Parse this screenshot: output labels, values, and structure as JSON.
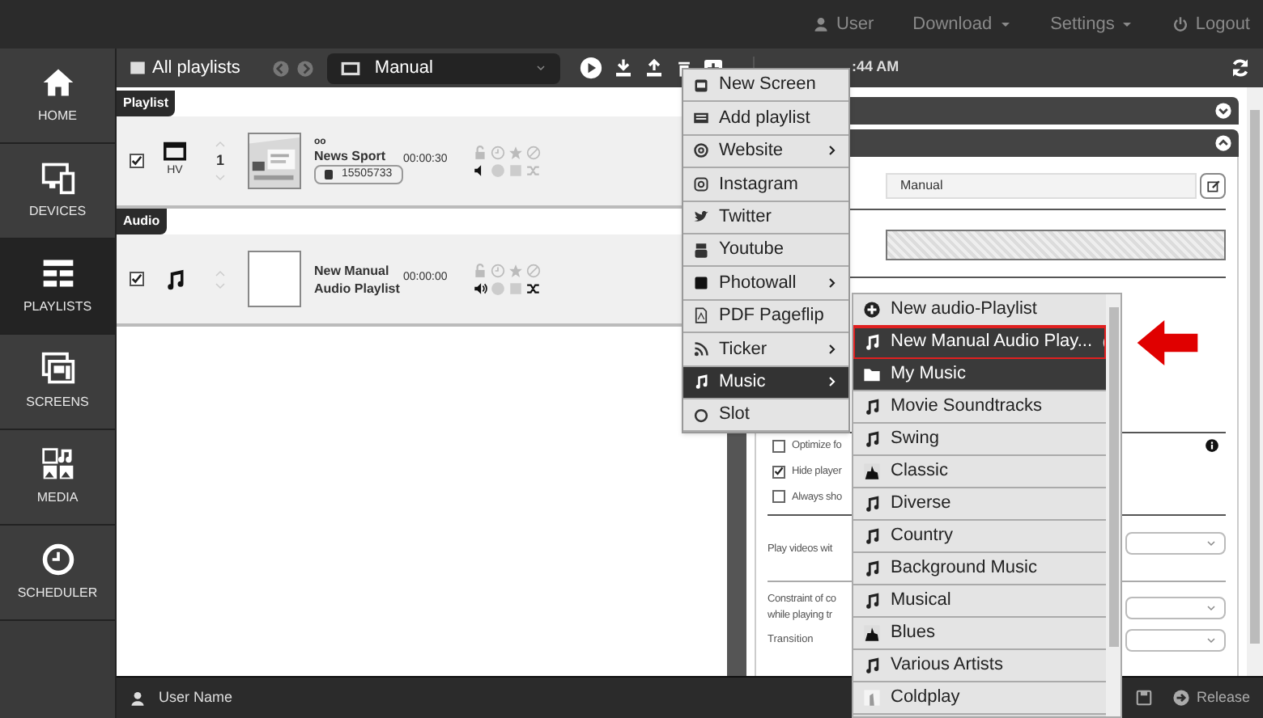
{
  "top_nav": {
    "user": "User",
    "download": "Download",
    "settings": "Settings",
    "logout": "Logout"
  },
  "sidebar": {
    "items": [
      {
        "label": "HOME",
        "kind": "home",
        "selected": false
      },
      {
        "label": "DEVICES",
        "kind": "devices",
        "selected": false
      },
      {
        "label": "PLAYLISTS",
        "kind": "playlists",
        "selected": true
      },
      {
        "label": "SCREENS",
        "kind": "screens",
        "selected": false
      },
      {
        "label": "MEDIA",
        "kind": "media",
        "selected": false
      },
      {
        "label": "SCHEDULER",
        "kind": "scheduler",
        "selected": false
      }
    ]
  },
  "toolbar": {
    "breadcrumb": "All playlists",
    "playlist_select": "Manual",
    "timestamp": ":44 AM"
  },
  "sections": [
    {
      "label": "Playlist",
      "rows": [
        {
          "kind": "screen",
          "checked": true,
          "orientation": "HV",
          "order": "1",
          "caption": "oo",
          "title": "News Sport",
          "id": "15505733",
          "duration": "00:00:30"
        }
      ]
    },
    {
      "label": "Audio",
      "rows": [
        {
          "kind": "audio",
          "checked": true,
          "title": "New Manual Audio Playlist",
          "duration": "00:00:00"
        }
      ]
    }
  ],
  "properties": {
    "name": "Manual",
    "checkboxes": [
      {
        "label": "Optimize fo",
        "checked": false
      },
      {
        "label": "Hide player",
        "checked": true
      },
      {
        "label": "Always sho",
        "checked": false
      }
    ],
    "play_videos_label": "Play videos wit",
    "constraint_label": [
      "Constraint of co",
      "while playing tr"
    ],
    "transition_label": "Transition"
  },
  "add_menu": [
    {
      "label": "New Screen",
      "kind": "screen",
      "submenu": false,
      "selected": false
    },
    {
      "label": "Add playlist",
      "kind": "playlist",
      "submenu": false,
      "selected": false
    },
    {
      "label": "Website",
      "kind": "website",
      "submenu": true,
      "selected": false
    },
    {
      "label": "Instagram",
      "kind": "instagram",
      "submenu": false,
      "selected": false
    },
    {
      "label": "Twitter",
      "kind": "twitter",
      "submenu": false,
      "selected": false
    },
    {
      "label": "Youtube",
      "kind": "youtube",
      "submenu": false,
      "selected": false
    },
    {
      "label": "Photowall",
      "kind": "photowall",
      "submenu": true,
      "selected": false
    },
    {
      "label": "PDF Pageflip",
      "kind": "pdf",
      "submenu": false,
      "selected": false
    },
    {
      "label": "Ticker",
      "kind": "ticker",
      "submenu": true,
      "selected": false
    },
    {
      "label": "Music",
      "kind": "music",
      "submenu": true,
      "selected": true
    },
    {
      "label": "Slot",
      "kind": "slot",
      "submenu": false,
      "selected": false
    }
  ],
  "music_menu": [
    {
      "label": "New audio-Playlist",
      "kind": "add",
      "selected": false,
      "highlighted": false
    },
    {
      "label": "New Manual Audio Play...",
      "kind": "audio",
      "selected": true,
      "highlighted": true
    },
    {
      "label": "My Music",
      "kind": "folder",
      "selected": true,
      "highlighted": false
    },
    {
      "label": "Movie Soundtracks",
      "kind": "audio",
      "selected": false,
      "highlighted": false
    },
    {
      "label": "Swing",
      "kind": "audio",
      "selected": false,
      "highlighted": false
    },
    {
      "label": "Classic",
      "kind": "artist",
      "selected": false,
      "highlighted": false
    },
    {
      "label": "Diverse",
      "kind": "audio",
      "selected": false,
      "highlighted": false
    },
    {
      "label": "Country",
      "kind": "audio",
      "selected": false,
      "highlighted": false
    },
    {
      "label": "Background Music",
      "kind": "audio",
      "selected": false,
      "highlighted": false
    },
    {
      "label": "Musical",
      "kind": "audio",
      "selected": false,
      "highlighted": false
    },
    {
      "label": "Blues",
      "kind": "artist",
      "selected": false,
      "highlighted": false
    },
    {
      "label": "Various Artists",
      "kind": "audio",
      "selected": false,
      "highlighted": false
    },
    {
      "label": "Coldplay",
      "selected": false,
      "highlighted": false
    }
  ],
  "status_bar": {
    "user_name": "User Name",
    "release": "Release"
  }
}
